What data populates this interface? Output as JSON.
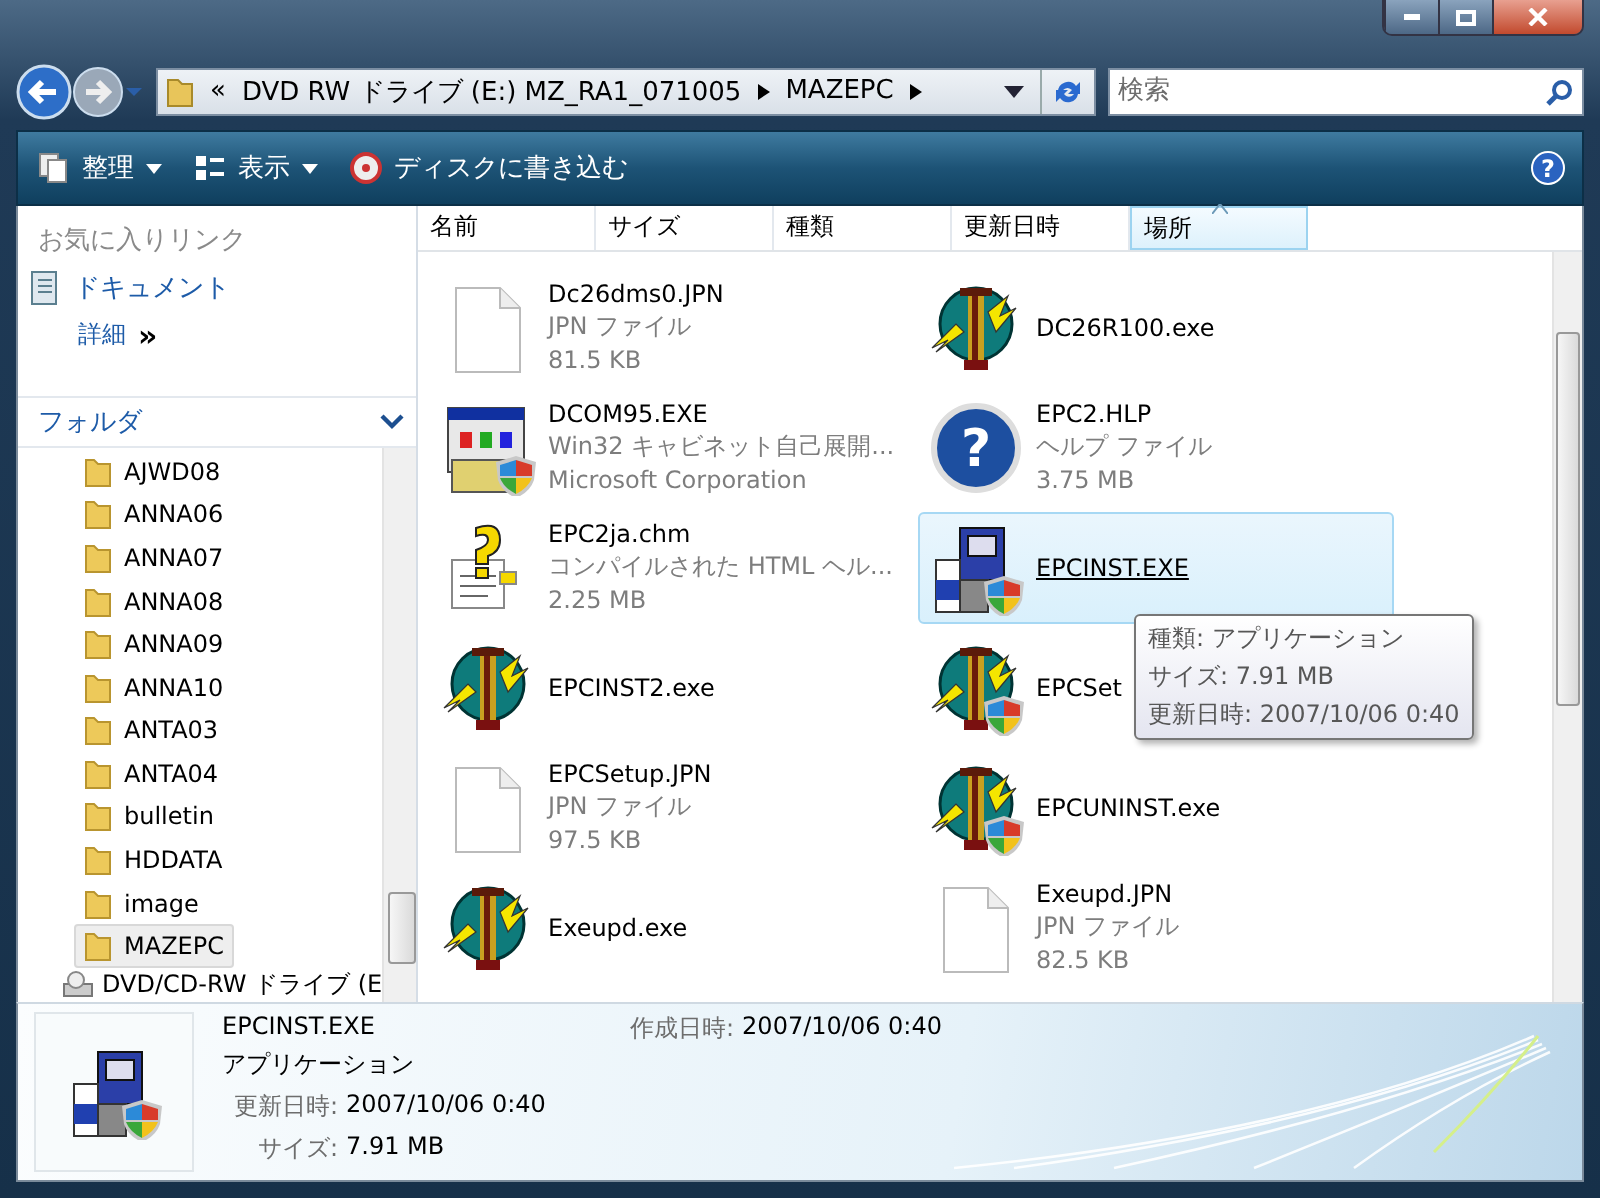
{
  "address": {
    "overflow": "«",
    "segments": [
      "DVD RW ドライブ (E:) MZ_RA1_071005",
      "MAZEPC"
    ]
  },
  "search": {
    "placeholder": "検索"
  },
  "toolbar": {
    "items": [
      {
        "label": "整理",
        "kind": "organize",
        "dropdown": true
      },
      {
        "label": "表示",
        "kind": "views",
        "dropdown": true
      },
      {
        "label": "ディスクに書き込む",
        "kind": "burn",
        "dropdown": false
      }
    ],
    "help_glyph": "?"
  },
  "nav_pane": {
    "favorites_title": "お気に入りリンク",
    "links": [
      {
        "label": "ドキュメント"
      }
    ],
    "more": {
      "label": "詳細",
      "glyph": "»"
    },
    "folders_title": "フォルダ",
    "folders": [
      {
        "label": "AJWD08",
        "selected": false
      },
      {
        "label": "ANNA06",
        "selected": false
      },
      {
        "label": "ANNA07",
        "selected": false
      },
      {
        "label": "ANNA08",
        "selected": false
      },
      {
        "label": "ANNA09",
        "selected": false
      },
      {
        "label": "ANNA10",
        "selected": false
      },
      {
        "label": "ANTA03",
        "selected": false
      },
      {
        "label": "ANTA04",
        "selected": false
      },
      {
        "label": "bulletin",
        "selected": false
      },
      {
        "label": "HDDATA",
        "selected": false
      },
      {
        "label": "image",
        "selected": false
      },
      {
        "label": "MAZEPC",
        "selected": true
      }
    ],
    "drive": "DVD/CD-RW ドライブ (E"
  },
  "columns": [
    {
      "label": "名前",
      "sorted": false
    },
    {
      "label": "サイズ",
      "sorted": false
    },
    {
      "label": "種類",
      "sorted": false
    },
    {
      "label": "更新日時",
      "sorted": false
    },
    {
      "label": "場所",
      "sorted": true
    }
  ],
  "files": [
    {
      "name": "Dc26dms0.JPN",
      "kind": "document",
      "lines": [
        "JPN ファイル",
        "81.5 KB"
      ],
      "selected": false
    },
    {
      "name": "DC26R100.exe",
      "kind": "tower",
      "selected": false
    },
    {
      "name": "DCOM95.EXE",
      "kind": "setup",
      "lines": [
        "Win32 キャビネット自己展開...",
        "Microsoft Corporation"
      ],
      "selected": false
    },
    {
      "name": "EPC2.HLP",
      "kind": "help",
      "glyph": "?",
      "lines": [
        "ヘルプ ファイル",
        "3.75 MB"
      ],
      "selected": false
    },
    {
      "name": "EPC2ja.chm",
      "kind": "chm",
      "lines": [
        "コンパイルされた HTML ヘル...",
        "2.25 MB"
      ],
      "selected": false
    },
    {
      "name": "EPCINST.EXE",
      "kind": "installer",
      "selected": true
    },
    {
      "name": "EPCINST2.exe",
      "kind": "tower",
      "selected": false
    },
    {
      "name": "EPCSet",
      "kind": "tower-shield",
      "selected": false
    },
    {
      "name": "EPCSetup.JPN",
      "kind": "document",
      "lines": [
        "JPN ファイル",
        "97.5 KB"
      ],
      "selected": false
    },
    {
      "name": "EPCUNINST.exe",
      "kind": "tower-shield",
      "selected": false
    },
    {
      "name": "Exeupd.exe",
      "kind": "tower",
      "selected": false
    },
    {
      "name": "Exeupd.JPN",
      "kind": "document",
      "lines": [
        "JPN ファイル",
        "82.5 KB"
      ],
      "selected": false
    }
  ],
  "tooltip": {
    "lines": [
      "種類: アプリケーション",
      "サイズ: 7.91 MB",
      "更新日時: 2007/10/06 0:40"
    ]
  },
  "details": {
    "name": "EPCINST.EXE",
    "type": "アプリケーション",
    "fields": [
      {
        "label": "更新日時:",
        "value": "2007/10/06 0:40"
      },
      {
        "label": "サイズ:",
        "value": "7.91 MB"
      }
    ],
    "side_fields": [
      {
        "label": "作成日時:",
        "value": "2007/10/06 0:40"
      }
    ]
  }
}
